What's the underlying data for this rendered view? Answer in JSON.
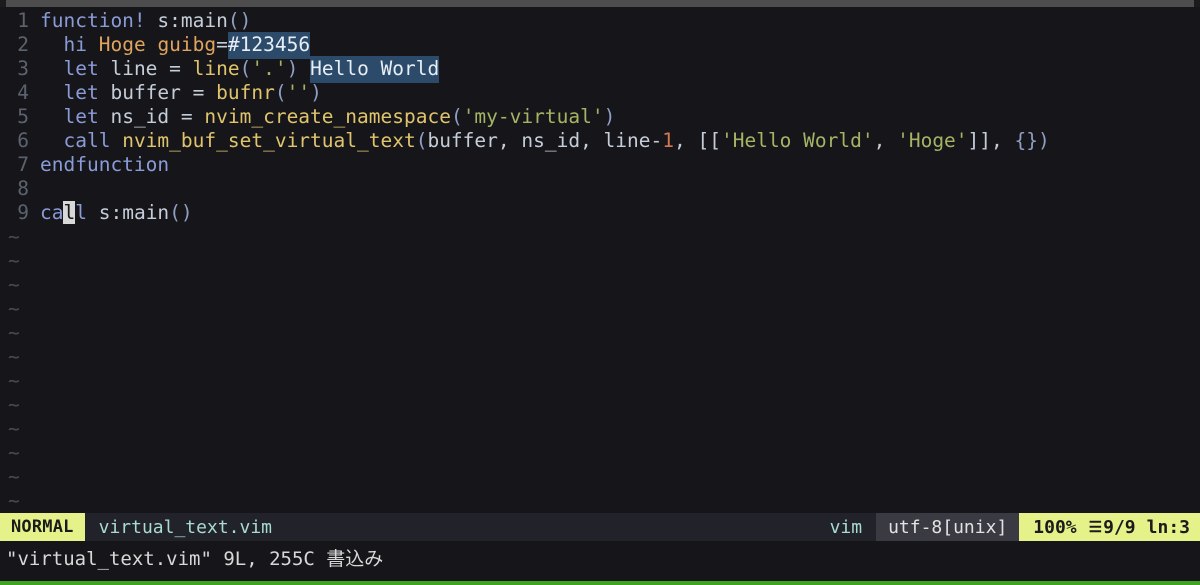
{
  "window": {
    "titlebar_color": "#4d4d4d",
    "background": "#16161a",
    "bottom_border_color": "#3fa321"
  },
  "editor": {
    "lines": [
      {
        "num": "1",
        "text": "function! s:main()"
      },
      {
        "num": "2",
        "text": "  hi Hoge guibg=#123456"
      },
      {
        "num": "3",
        "text": "  let line = line('.') Hello World"
      },
      {
        "num": "4",
        "text": "  let buffer = bufnr('')"
      },
      {
        "num": "5",
        "text": "  let ns_id = nvim_create_namespace('my-virtual')"
      },
      {
        "num": "6",
        "text": "  call nvim_buf_set_virtual_text(buffer, ns_id, line-1, [['Hello World', 'Hoge']], {})"
      },
      {
        "num": "7",
        "text": "endfunction"
      },
      {
        "num": "8",
        "text": ""
      },
      {
        "num": "9",
        "text": "call s:main()"
      }
    ],
    "tokens": {
      "l1": {
        "kw": "function!",
        "sp": " ",
        "ident": "s:main",
        "paren": "()"
      },
      "l2": {
        "indent": "  ",
        "kw": "hi",
        "sp": " ",
        "type1": "Hoge",
        "sp2": " ",
        "type2": "guibg",
        "eq": "=",
        "vt": "#123456"
      },
      "l3": {
        "indent": "  ",
        "kw": "let",
        "ident": " line ",
        "eq": "= ",
        "func": "line",
        "p1": "(",
        "str": "'.'",
        "p2": ")",
        "sp": " ",
        "vt": "Hello World"
      },
      "l4": {
        "indent": "  ",
        "kw": "let",
        "ident": " buffer ",
        "eq": "= ",
        "func": "bufnr",
        "p1": "(",
        "str": "''",
        "p2": ")"
      },
      "l5": {
        "indent": "  ",
        "kw": "let",
        "ident": " ns_id ",
        "eq": "= ",
        "func": "nvim_create_namespace",
        "p1": "(",
        "str": "'my-virtual'",
        "p2": ")"
      },
      "l6": {
        "indent": "  ",
        "kw": "call",
        "sp": " ",
        "func": "nvim_buf_set_virtual_text",
        "p1": "(",
        "args": "buffer, ns_id, line-",
        "num": "1",
        "mid": ", [[",
        "str1": "'Hello World'",
        "comma": ", ",
        "str2": "'Hoge'",
        "tail": "]], ",
        "brace": "{}",
        "p2": ")"
      },
      "l7": {
        "kw": "endfunction"
      },
      "l9": {
        "pre": "ca",
        "cursor": "l",
        "post": "l",
        "sp": " ",
        "ident": "s:main",
        "paren": "()"
      }
    },
    "empty_line_marker": "~",
    "empty_line_count": 12,
    "virtual_text_highlight": "#2c4a69",
    "cursor_color": "#d8d8d8"
  },
  "statusline": {
    "mode": "NORMAL",
    "filename": "virtual_text.vim",
    "filetype": "vim",
    "encoding": "utf-8[unix]",
    "percent": "100%",
    "lines_icon": "☰",
    "line_position": "9/9",
    "col_label": "ln",
    "col_sep": ":",
    "col_value": "3",
    "mode_bg": "#e5f28a",
    "pos_bg": "#e5f28a",
    "enc_bg": "#3a3a42"
  },
  "message": {
    "text": "\"virtual_text.vim\" 9L, 255C 書込み"
  }
}
